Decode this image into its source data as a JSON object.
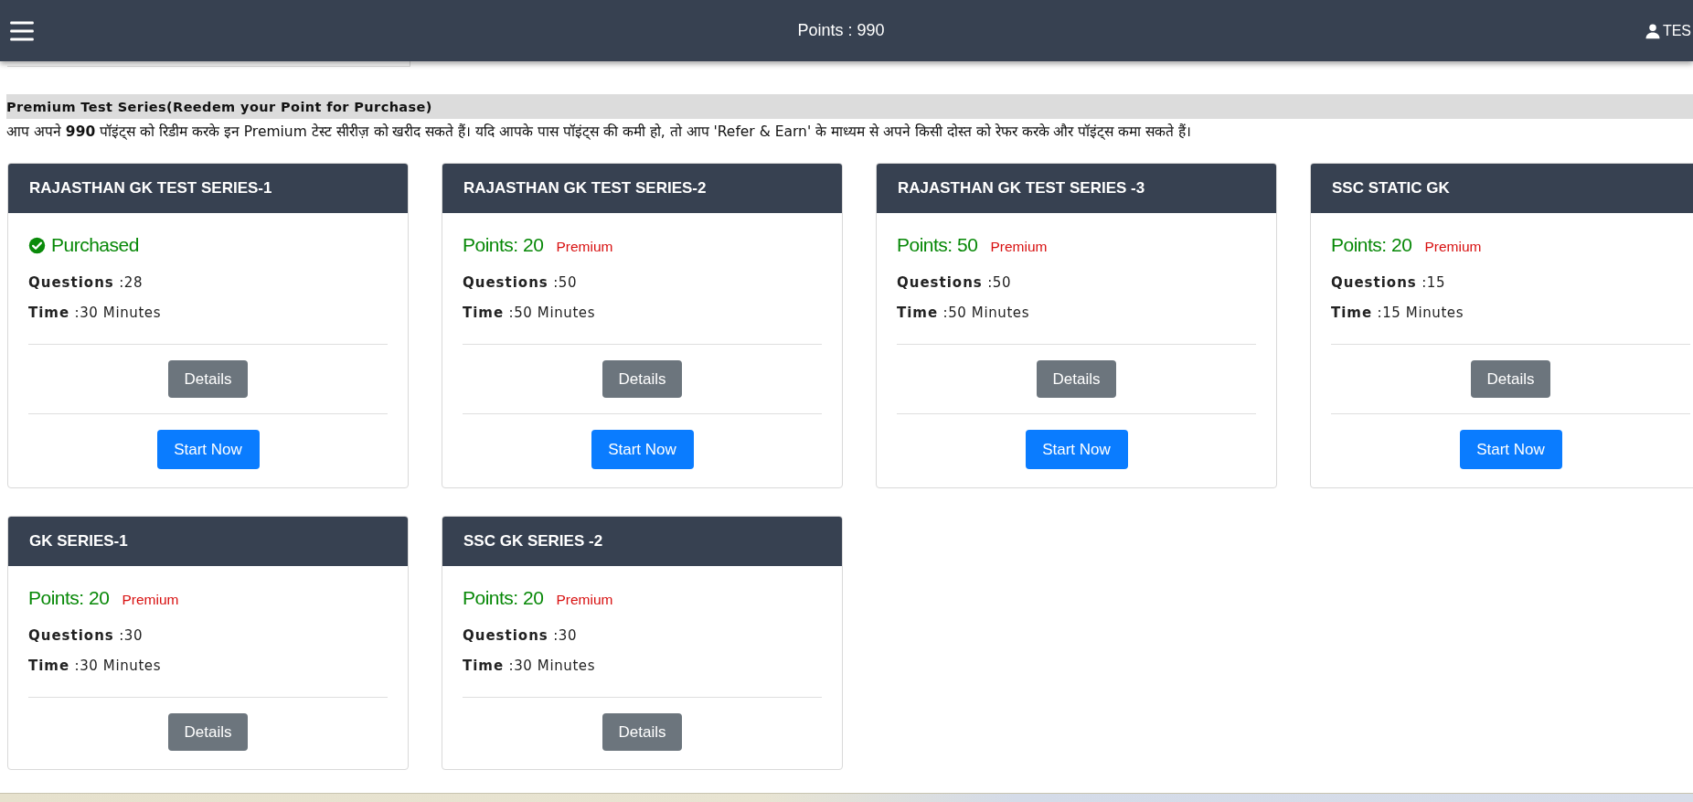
{
  "navbar": {
    "points": "Points : 990",
    "user": "TES"
  },
  "section": {
    "title": "Premium Test Series(Reedem your Point for Purchase)",
    "description": "आप अपने **990** पॉइंट्स को रिडीम करके इन Premium टेस्ट सीरीज़ को खरीद सकते हैं। यदि आपके पास पॉइंट्स की कमी हो, तो आप 'Refer & Earn' के माध्यम से अपने किसी दोस्त को रेफर करके और पॉइंट्स कमा सकते हैं।"
  },
  "cards": [
    {
      "title": "RAJASTHAN GK TEST SERIES-1",
      "status": {
        "kind": "purchased",
        "text": "Purchased"
      },
      "questions": "**Questions** :28",
      "time": "**Time** :30 Minutes",
      "buttons": [
        {
          "kind": "details",
          "label": "Details"
        },
        {
          "kind": "start",
          "label": "Start Now"
        }
      ]
    },
    {
      "title": "RAJASTHAN GK TEST SERIES-2",
      "status": {
        "kind": "points",
        "text": "Points: 20",
        "badge": "Premium"
      },
      "questions": "**Questions** :50",
      "time": "**Time** :50 Minutes",
      "buttons": [
        {
          "kind": "details",
          "label": "Details"
        },
        {
          "kind": "start",
          "label": "Start Now"
        }
      ]
    },
    {
      "title": "RAJASTHAN GK TEST SERIES -3",
      "status": {
        "kind": "points",
        "text": "Points: 50",
        "badge": "Premium"
      },
      "questions": "**Questions** :50",
      "time": "**Time** :50 Minutes",
      "buttons": [
        {
          "kind": "details",
          "label": "Details"
        },
        {
          "kind": "start",
          "label": "Start Now"
        }
      ]
    },
    {
      "title": "SSC STATIC GK",
      "status": {
        "kind": "points",
        "text": "Points: 20",
        "badge": "Premium"
      },
      "questions": "**Questions** :15",
      "time": "**Time** :15 Minutes",
      "buttons": [
        {
          "kind": "details",
          "label": "Details"
        },
        {
          "kind": "start",
          "label": "Start Now"
        }
      ]
    },
    {
      "title": "GK SERIES-1",
      "status": {
        "kind": "points",
        "text": "Points: 20",
        "badge": "Premium"
      },
      "questions": "**Questions** :30",
      "time": "**Time** :30 Minutes",
      "buttons": [
        {
          "kind": "details",
          "label": "Details"
        }
      ]
    },
    {
      "title": "SSC GK SERIES -2",
      "status": {
        "kind": "points",
        "text": "Points: 20",
        "badge": "Premium"
      },
      "questions": "**Questions** :30",
      "time": "**Time** :30 Minutes",
      "buttons": [
        {
          "kind": "details",
          "label": "Details"
        }
      ]
    }
  ]
}
